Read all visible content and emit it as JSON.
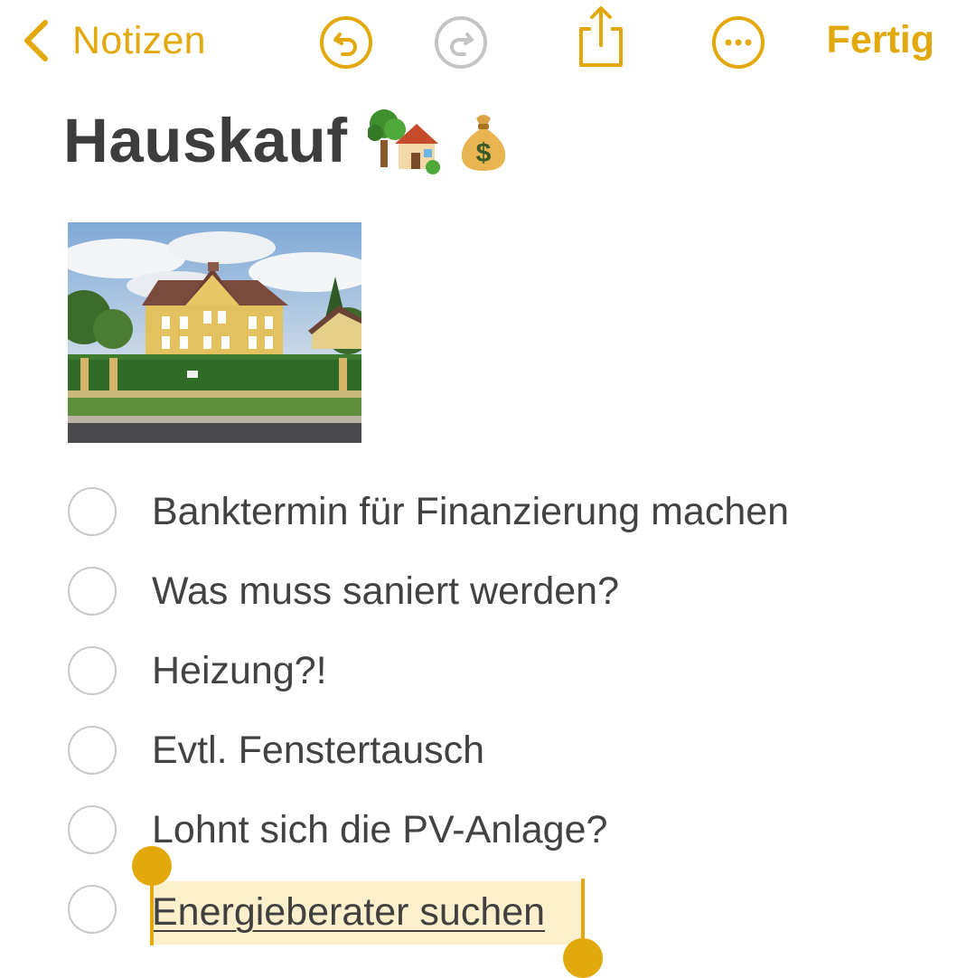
{
  "nav": {
    "back_label": "Notizen",
    "done_label": "Fertig",
    "icons": [
      "chevron-left-icon",
      "undo-icon",
      "redo-icon",
      "share-icon",
      "more-icon"
    ]
  },
  "note": {
    "title": "Hauskauf",
    "title_emojis": [
      "tree-icon",
      "house-with-garden-icon",
      "money-bag-icon"
    ],
    "image": "house-photo",
    "checklist": [
      {
        "label": "Banktermin für Finanzierung machen",
        "checked": false
      },
      {
        "label": "Was muss saniert werden?",
        "checked": false
      },
      {
        "label": "Heizung?!",
        "checked": false
      },
      {
        "label": "Evtl. Fenstertausch",
        "checked": false
      },
      {
        "label": "Lohnt sich die PV-Anlage?",
        "checked": false
      },
      {
        "label": "Energieberater suchen",
        "checked": false,
        "selected": true
      }
    ]
  },
  "colors": {
    "accent": "#e3a90c",
    "selection": "#fbefcc",
    "checkbox_border": "#c8c8c8",
    "text": "#424242"
  }
}
